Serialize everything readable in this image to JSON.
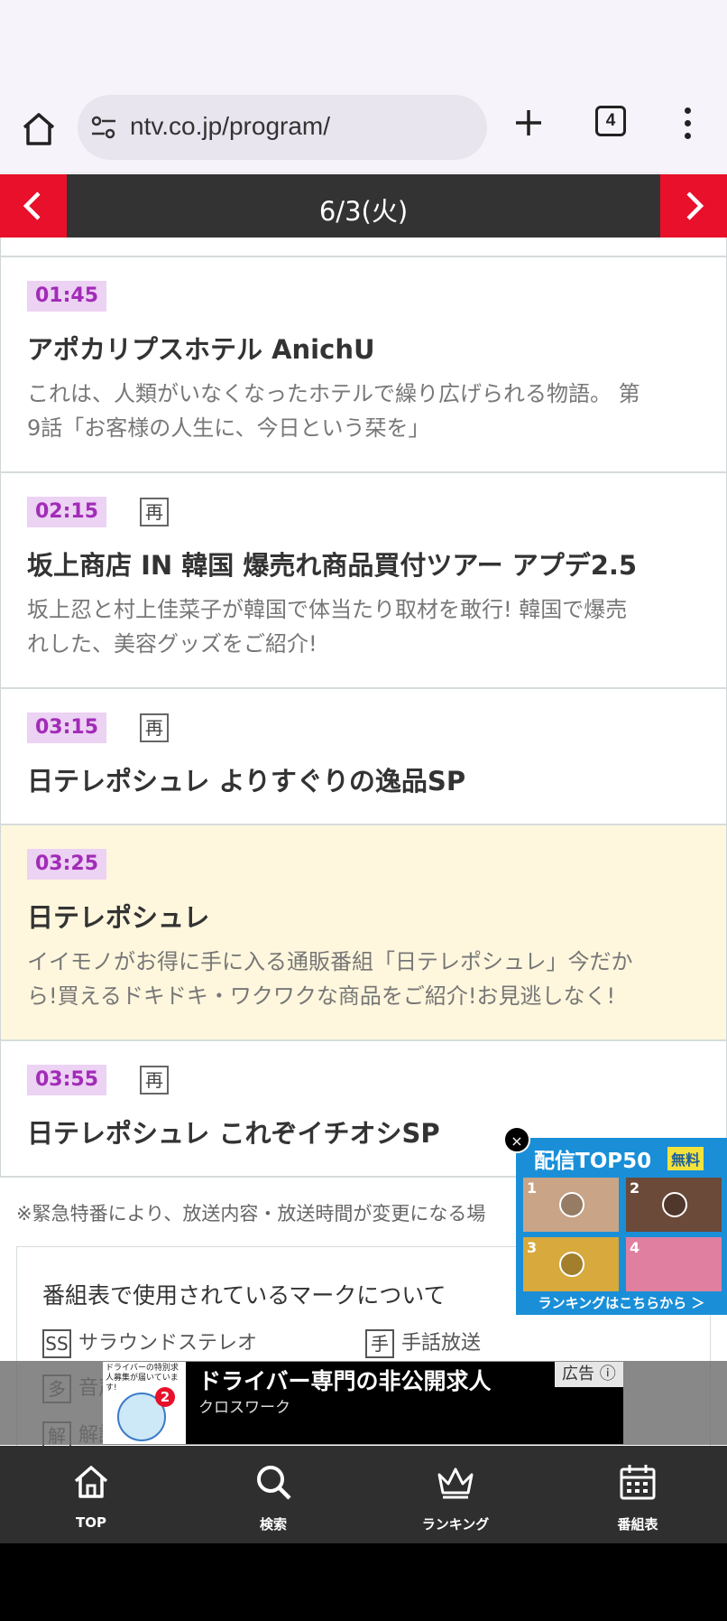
{
  "browser": {
    "url": "ntv.co.jp/program/",
    "tab_count": "4"
  },
  "date_nav": {
    "date": "6/3(火)"
  },
  "programs": [
    {
      "time": "01:45",
      "rerun": "",
      "title": "アポカリプスホテル AnichU",
      "desc_lines": [
        "これは、人類がいなくなったホテルで繰り広げられる物語。 第",
        "9話「お客様の人生に、今日という栞を」"
      ],
      "highlight": false
    },
    {
      "time": "02:15",
      "rerun": "再",
      "title": "坂上商店 IN 韓国 爆売れ商品買付ツアー アプデ2.5",
      "desc_lines": [
        "坂上忍と村上佳菜子が韓国で体当たり取材を敢行! 韓国で爆売",
        "れした、美容グッズをご紹介!"
      ],
      "highlight": false
    },
    {
      "time": "03:15",
      "rerun": "再",
      "title": "日テレポシュレ よりすぐりの逸品SP",
      "desc_lines": [],
      "highlight": false
    },
    {
      "time": "03:25",
      "rerun": "",
      "title": "日テレポシュレ",
      "desc_lines": [
        "イイモノがお得に手に入る通販番組「日テレポシュレ」今だか",
        "ら!買えるドキドキ・ワクワクな商品をご紹介!お見逃しなく!"
      ],
      "highlight": true
    },
    {
      "time": "03:55",
      "rerun": "再",
      "title": "日テレポシュレ これぞイチオシSP",
      "desc_lines": [],
      "highlight": false
    }
  ],
  "notice": "※緊急特番により、放送内容・放送時間が変更になる場",
  "legend": {
    "title": "番組表で使用されているマークについて",
    "items": [
      {
        "mark": "SS",
        "label": "サラウンドステレオ"
      },
      {
        "mark": "手",
        "label": "手話放送"
      },
      {
        "mark": "多",
        "label": "音声"
      },
      {
        "mark": "解",
        "label": "解説"
      }
    ]
  },
  "ad_banner": {
    "thumb_text": "ドライバーの特別求人募集が届いています!",
    "badge": "2",
    "headline": "ドライバー専門の非公開求人",
    "sub": "クロスワーク",
    "label": "広告"
  },
  "float_ad": {
    "close": "×",
    "title": "配信TOP50",
    "free": "無料",
    "ranks": [
      "1",
      "2",
      "3",
      "4"
    ],
    "link": "ランキングはこちらから ＞"
  },
  "bottom_nav": {
    "items": [
      "TOP",
      "検索",
      "ランキング",
      "番組表"
    ]
  },
  "colors": {
    "accent_red": "#e8102a",
    "time_badge_bg": "#ecd2f3",
    "time_badge_text": "#a22bb8",
    "highlight_row": "#fff7dd",
    "nav_bg": "#2f2f2f"
  }
}
